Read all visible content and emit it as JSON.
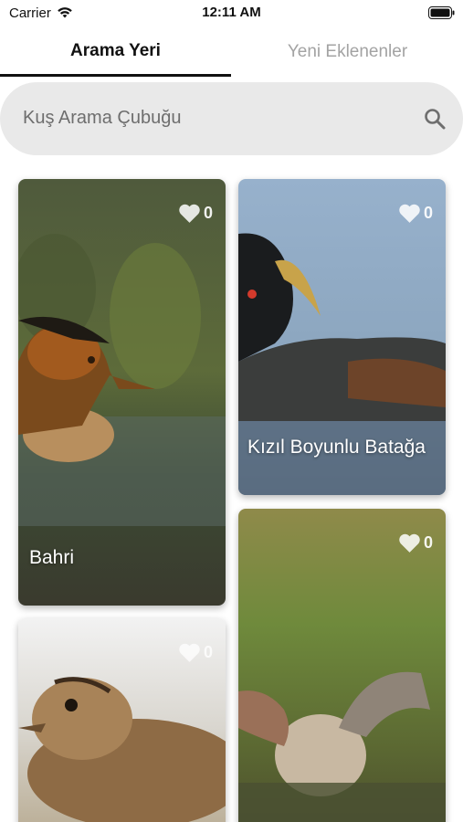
{
  "status_bar": {
    "carrier": "Carrier",
    "time": "12:11 AM"
  },
  "tabs": [
    {
      "label": "Arama Yeri",
      "active": true
    },
    {
      "label": "Yeni Eklenenler",
      "active": false
    }
  ],
  "search": {
    "placeholder": "Kuş Arama Çubuğu",
    "icon": "search-icon"
  },
  "birds": [
    {
      "name": "Bahri",
      "likes": "0"
    },
    {
      "name": "Kızıl Boyunlu Batağa",
      "likes": "0"
    },
    {
      "name": "",
      "likes": "0"
    },
    {
      "name": "",
      "likes": "0"
    }
  ],
  "colors": {
    "search_background": "#e9e9e9",
    "inactive_tab": "#a3a3a3",
    "active_tab": "#111111"
  }
}
